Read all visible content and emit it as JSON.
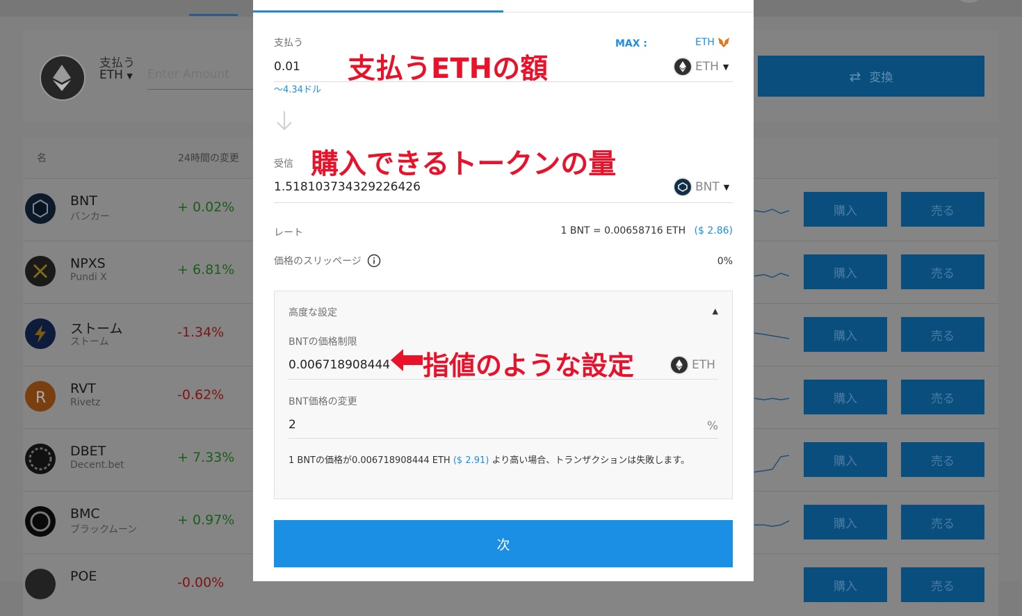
{
  "background": {
    "pay_label": "支払う",
    "pay_token": "ETH",
    "amount_placeholder": "Enter Amount",
    "convert_label": "変換",
    "table_headers": {
      "name": "名",
      "change": "24時間の変更"
    },
    "rows": [
      {
        "symbol": "BNT",
        "name": "バンカー",
        "change": "+ 0.02%",
        "buy": "購入",
        "sell": "売る"
      },
      {
        "symbol": "NPXS",
        "name": "Pundi X",
        "change": "+ 6.81%",
        "buy": "購入",
        "sell": "売る"
      },
      {
        "symbol": "ストーム",
        "name": "ストーム",
        "change": "-1.34%",
        "buy": "購入",
        "sell": "売る"
      },
      {
        "symbol": "RVT",
        "name": "Rivetz",
        "change": "-0.62%",
        "buy": "購入",
        "sell": "売る"
      },
      {
        "symbol": "DBET",
        "name": "Decent.bet",
        "change": "+ 7.33%",
        "buy": "購入",
        "sell": "売る"
      },
      {
        "symbol": "BMC",
        "name": "ブラックムーン",
        "change": "+ 0.97%",
        "buy": "購入",
        "sell": "売る"
      },
      {
        "symbol": "POE",
        "name": "",
        "change": "-0.00%",
        "buy": "購入",
        "sell": "売る"
      }
    ]
  },
  "modal": {
    "pay": {
      "label": "支払う",
      "max_label": "MAX :",
      "max_token": "ETH",
      "amount": "0.01",
      "token": "ETH",
      "usd_equiv": "～4.34ドル"
    },
    "receive": {
      "label": "受信",
      "amount": "1.518103734329226426",
      "token": "BNT"
    },
    "rate": {
      "label": "レート",
      "value": "1 BNT = 0.00658716 ETH",
      "usd": "($ 2.86)"
    },
    "slippage": {
      "label": "価格のスリッページ",
      "value": "0%"
    },
    "advanced": {
      "title": "高度な設定",
      "price_limit_label": "BNTの価格制限",
      "price_limit_value": "0.006718908444",
      "price_limit_token": "ETH",
      "price_change_label": "BNT価格の変更",
      "price_change_value": "2",
      "price_change_unit": "%",
      "note_part1": "1 BNTの価格が0.006718908444 ETH",
      "note_usd": "($ 2.91)",
      "note_part2": "より高い場合、トランザクションは失敗します。"
    },
    "next_label": "次"
  },
  "annotations": {
    "pay_amount": "支払うETHの額",
    "receive_amount": "購入できるトークンの量",
    "limit_order": "指値のような設定"
  },
  "colors": {
    "accent": "#1a8fe3",
    "annotation_red": "#e8132b"
  }
}
